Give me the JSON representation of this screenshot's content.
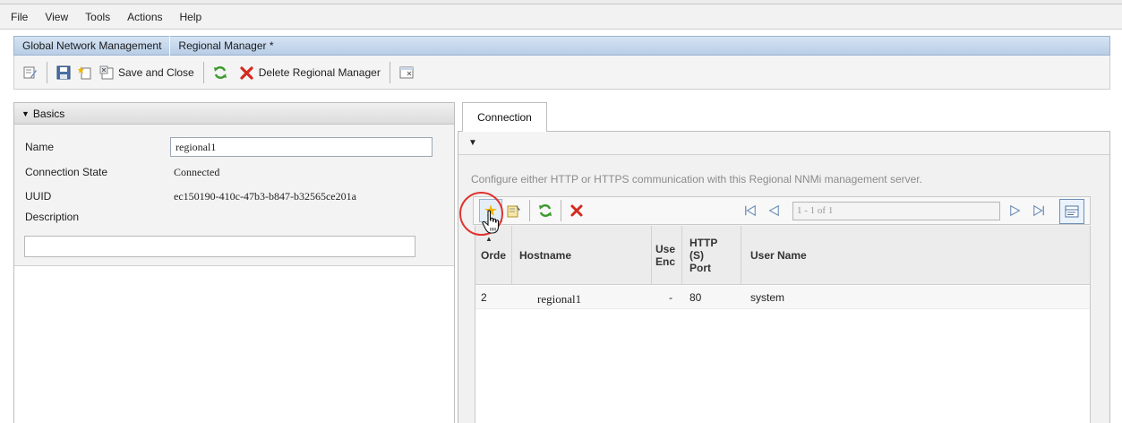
{
  "menu": [
    "File",
    "View",
    "Tools",
    "Actions",
    "Help"
  ],
  "breadcrumb": {
    "first": "Global Network Management",
    "second": "Regional Manager *"
  },
  "toolbar": {
    "save_close_label": "Save and Close",
    "delete_label": "Delete Regional Manager"
  },
  "basics": {
    "header": "Basics",
    "name_label": "Name",
    "name_value": "regional1",
    "connection_state_label": "Connection State",
    "connection_state_value": "Connected",
    "uuid_label": "UUID",
    "uuid_value": "ec150190-410c-47b3-b847-b32565ce201a",
    "description_label": "Description",
    "description_value": ""
  },
  "connection": {
    "tab_label": "Connection",
    "hint": "Configure either HTTP or HTTPS communication with this Regional NNMi management server.",
    "pager": "1 - 1 of 1",
    "columns": {
      "order": "Orde",
      "hostname": "Hostname",
      "use_enc_1": "Use",
      "use_enc_2": "Enc",
      "port_1": "HTTP",
      "port_2": "(S)",
      "port_3": "Port",
      "user_name": "User Name"
    },
    "rows": [
      {
        "order": "2",
        "hostname": "regional1",
        "use_enc": "-",
        "port": "80",
        "user_name": "system"
      }
    ]
  },
  "colors": {
    "accent_tab": "#b8cde6",
    "highlight": "#e0332d",
    "refresh_green": "#3a9a2b",
    "delete_red": "#d42a1e"
  }
}
